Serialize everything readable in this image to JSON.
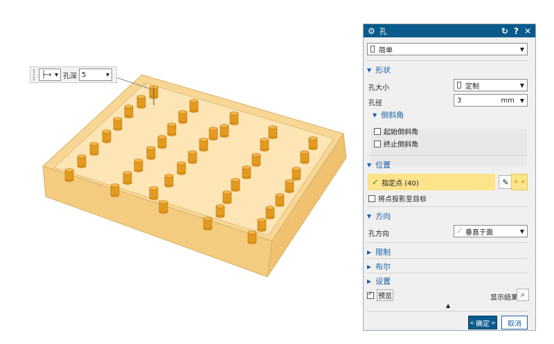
{
  "toolbar_float": {
    "depth_label": "孔深",
    "depth_value": "5",
    "type_glyph": "├→"
  },
  "dialog": {
    "title": "孔",
    "type_value": "简单",
    "sections": {
      "shape": "形状",
      "position": "位置",
      "direction": "方向",
      "limit": "限制",
      "boolean": "布尔",
      "settings": "设置"
    },
    "hole_size_label": "孔大小",
    "hole_size_value": "定制",
    "diameter_label": "孔径",
    "diameter_value": "3",
    "diameter_unit": "mm",
    "chamfer_group": "倒斜角",
    "start_chamfer": "起始倒斜角",
    "end_chamfer": "终止倒斜角",
    "specify_point": "指定点 (40)",
    "project_points": "将点投影至目标",
    "hole_direction_label": "孔方向",
    "hole_direction_value": "垂直于面",
    "preview": "预览",
    "show_result": "显示结果",
    "ok": "确定",
    "cancel": "取消"
  },
  "colors": {
    "title_bar": "#0b5a8c",
    "section_text": "#1d5fa8",
    "highlight": "#fde38a",
    "part_fill": "#f9d89a",
    "peg": "#e39a1e"
  }
}
